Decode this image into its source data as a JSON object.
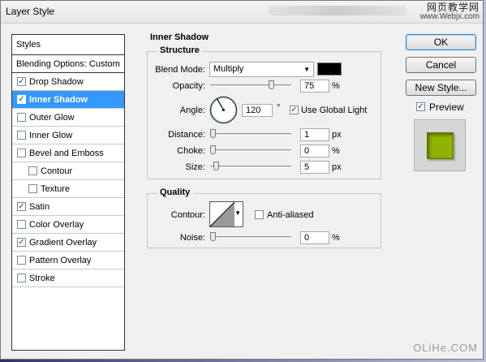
{
  "window": {
    "title": "Layer Style",
    "watermark_top_line1": "网页教学网",
    "watermark_top_line2": "www.Webjx.com",
    "watermark_bottom": "OLiHe.COM"
  },
  "style_list": {
    "header": "Styles",
    "blending": "Blending Options: Custom",
    "items": [
      {
        "label": "Drop Shadow",
        "checked": true
      },
      {
        "label": "Inner Shadow",
        "checked": true,
        "selected": true
      },
      {
        "label": "Outer Glow",
        "checked": false
      },
      {
        "label": "Inner Glow",
        "checked": false
      },
      {
        "label": "Bevel and Emboss",
        "checked": false
      },
      {
        "label": "Contour",
        "checked": false,
        "indent": true
      },
      {
        "label": "Texture",
        "checked": false,
        "indent": true
      },
      {
        "label": "Satin",
        "checked": true
      },
      {
        "label": "Color Overlay",
        "checked": false
      },
      {
        "label": "Gradient Overlay",
        "checked": true
      },
      {
        "label": "Pattern Overlay",
        "checked": false
      },
      {
        "label": "Stroke",
        "checked": false
      }
    ]
  },
  "inner_shadow": {
    "section_title": "Inner Shadow",
    "structure_title": "Structure",
    "blend_mode_label": "Blend Mode:",
    "blend_mode_value": "Multiply",
    "blend_color": "#000000",
    "opacity_label": "Opacity:",
    "opacity_value": "75",
    "opacity_unit": "%",
    "opacity_level": 0.75,
    "angle_label": "Angle:",
    "angle_value": "120",
    "angle_unit": "°",
    "use_global_light_label": "Use Global Light",
    "use_global_light_checked": true,
    "distance_label": "Distance:",
    "distance_value": "1",
    "distance_unit": "px",
    "choke_label": "Choke:",
    "choke_value": "0",
    "choke_unit": "%",
    "size_label": "Size:",
    "size_value": "5",
    "size_unit": "px",
    "quality_title": "Quality",
    "contour_label": "Contour:",
    "anti_aliased_label": "Anti-aliased",
    "anti_aliased_checked": false,
    "noise_label": "Noise:",
    "noise_value": "0",
    "noise_unit": "%"
  },
  "buttons": {
    "ok": "OK",
    "cancel": "Cancel",
    "new_style": "New Style...",
    "preview_label": "Preview",
    "preview_checked": true,
    "preview_swatch_color": "#8fb300"
  }
}
